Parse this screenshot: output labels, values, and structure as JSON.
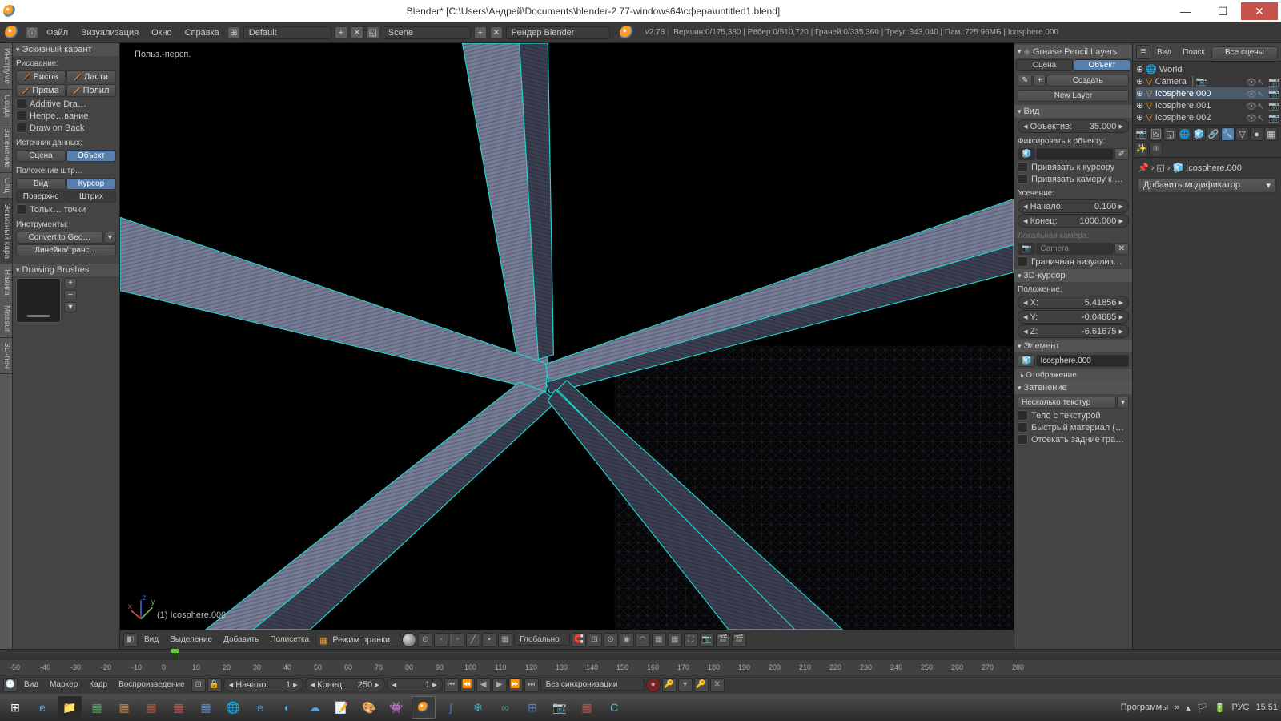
{
  "titlebar": {
    "title": "Blender* [C:\\Users\\Андрей\\Documents\\blender-2.77-windows64\\сфера\\untitled1.blend]"
  },
  "menubar": {
    "file": "Файл",
    "render": "Визуализация",
    "window": "Окно",
    "help": "Справка",
    "layout_preset": "Default",
    "scene": "Scene",
    "engine": "Рендер Blender",
    "version": "v2.78",
    "stats": "Вершин:0/175,380 | Рёбер:0/510,720 | Граней:0/335,360 | Треуг.:343,040 | Пам.:725.96MБ | Icosphere.000"
  },
  "left_tabs": [
    "Инструме",
    "Созда",
    "Затенение",
    "Опц",
    "Эскизный кара",
    "Навига",
    "Measur",
    "3D-печ"
  ],
  "left_panel": {
    "header": "Эскизный карант",
    "draw_label": "Рисование:",
    "btn_draw": "Рисов",
    "btn_erase": "Ласти",
    "btn_line": "Пряма",
    "btn_poly": "Полил",
    "chk_additive": "Additive Dra…",
    "chk_continuous": "Непре…вание",
    "chk_back": "Draw on Back",
    "source_label": "Источник данных:",
    "src_scene": "Сцена",
    "src_object": "Объект",
    "stroke_label": "Положение штр…",
    "pos_view": "Вид",
    "pos_cursor": "Курсор",
    "pos_surface": "Поверхнс",
    "pos_stroke": "Штрих",
    "chk_points": "Тольк… точки",
    "tools_label": "Инструменты:",
    "convert": "Convert to Geo…",
    "ruler": "Линейка/транс…",
    "brushes_header": "Drawing Brushes"
  },
  "viewport": {
    "projection": "Польз.-персп.",
    "object_info": "(1) Icosphere.000"
  },
  "right_panel": {
    "header": "Grease Pencil Layers",
    "tab_scene": "Сцена",
    "tab_object": "Объект",
    "create": "Создать",
    "new_layer": "New Layer",
    "view_header": "Вид",
    "lens_label": "Объектив:",
    "lens_val": "35.000",
    "lock_label": "Фиксировать к объекту:",
    "chk_cursor_lock": "Привязать к курсору",
    "chk_cam_lock": "Привязать камеру к …",
    "clip_label": "Усечение:",
    "clip_start_label": "Начало:",
    "clip_start_val": "0.100",
    "clip_end_label": "Конец:",
    "clip_end_val": "1000.000",
    "local_cam_label": "Локальная камера:",
    "local_cam": "Camera",
    "chk_border": "Граничная визуализ…",
    "cursor3d_header": "3D-курсор",
    "pos_label": "Положение:",
    "x": "5.41856",
    "y": "-0.04685",
    "z": "-6.61675",
    "elem_header": "Элемент",
    "elem_name": "Icosphere.000",
    "display_header": "Отображение",
    "shading_header": "Затенение",
    "shading_mode": "Несколько текстур",
    "chk_textured": "Тело с текстурой",
    "chk_material": "Быстрый материал (…",
    "chk_backface": "Отсекать задние гра…"
  },
  "far_right": {
    "top_view": "Вид",
    "top_search": "Поиск",
    "top_scenes": "Все сцены",
    "outliner": [
      "World",
      "Camera",
      "Icosphere.000",
      "Icosphere.001",
      "Icosphere.002"
    ],
    "active_name": "Icosphere.000",
    "add_modifier": "Добавить модификатор"
  },
  "viewport_header": {
    "view": "Вид",
    "select": "Выделение",
    "add": "Добавить",
    "mesh": "Полисетка",
    "mode": "Режим правки",
    "orientation": "Глобально"
  },
  "timeline": {
    "view": "Вид",
    "marker": "Маркер",
    "frame": "Кадр",
    "playback": "Воспроизведение",
    "start_label": "Начало:",
    "start_val": "1",
    "end_label": "Конец:",
    "end_val": "250",
    "current": "1",
    "sync": "Без синхронизации",
    "ticks": [
      "-50",
      "-40",
      "-30",
      "-20",
      "-10",
      "0",
      "10",
      "20",
      "30",
      "40",
      "50",
      "60",
      "70",
      "80",
      "90",
      "100",
      "110",
      "120",
      "130",
      "140",
      "150",
      "160",
      "170",
      "180",
      "190",
      "200",
      "210",
      "220",
      "230",
      "240",
      "250",
      "260",
      "270",
      "280"
    ]
  },
  "taskbar": {
    "programs": "Программы",
    "lang": "РУС",
    "time": "15:51"
  }
}
